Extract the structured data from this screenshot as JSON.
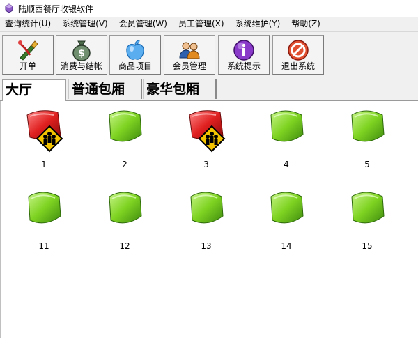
{
  "window": {
    "title": "陆顺西餐厅收银软件"
  },
  "menu": [
    {
      "label": "查询统计(U)"
    },
    {
      "label": "系统管理(V)"
    },
    {
      "label": "会员管理(W)"
    },
    {
      "label": "员工管理(X)"
    },
    {
      "label": "系统维护(Y)"
    },
    {
      "label": "帮助(Z)"
    }
  ],
  "toolbar": [
    {
      "label": "开单",
      "icon": "brush-icon"
    },
    {
      "label": "消费与结帐",
      "icon": "money-bag-icon"
    },
    {
      "label": "商品项目",
      "icon": "apple-icon"
    },
    {
      "label": "会员管理",
      "icon": "people-icon"
    },
    {
      "label": "系统提示",
      "icon": "info-icon"
    },
    {
      "label": "退出系统",
      "icon": "exit-icon"
    }
  ],
  "tabs": [
    {
      "label": "大厅",
      "active": true
    },
    {
      "label": "普通包厢",
      "active": false
    },
    {
      "label": "豪华包厢",
      "active": false
    }
  ],
  "tables": [
    {
      "number": "1",
      "status": "occupied"
    },
    {
      "number": "2",
      "status": "free"
    },
    {
      "number": "3",
      "status": "occupied"
    },
    {
      "number": "4",
      "status": "free"
    },
    {
      "number": "5",
      "status": "free"
    },
    {
      "number": "11",
      "status": "free"
    },
    {
      "number": "12",
      "status": "free"
    },
    {
      "number": "13",
      "status": "free"
    },
    {
      "number": "14",
      "status": "free"
    },
    {
      "number": "15",
      "status": "free"
    }
  ],
  "colors": {
    "free": "#7ed321",
    "occupied": "#d0021b",
    "warning": "#f5c400"
  }
}
